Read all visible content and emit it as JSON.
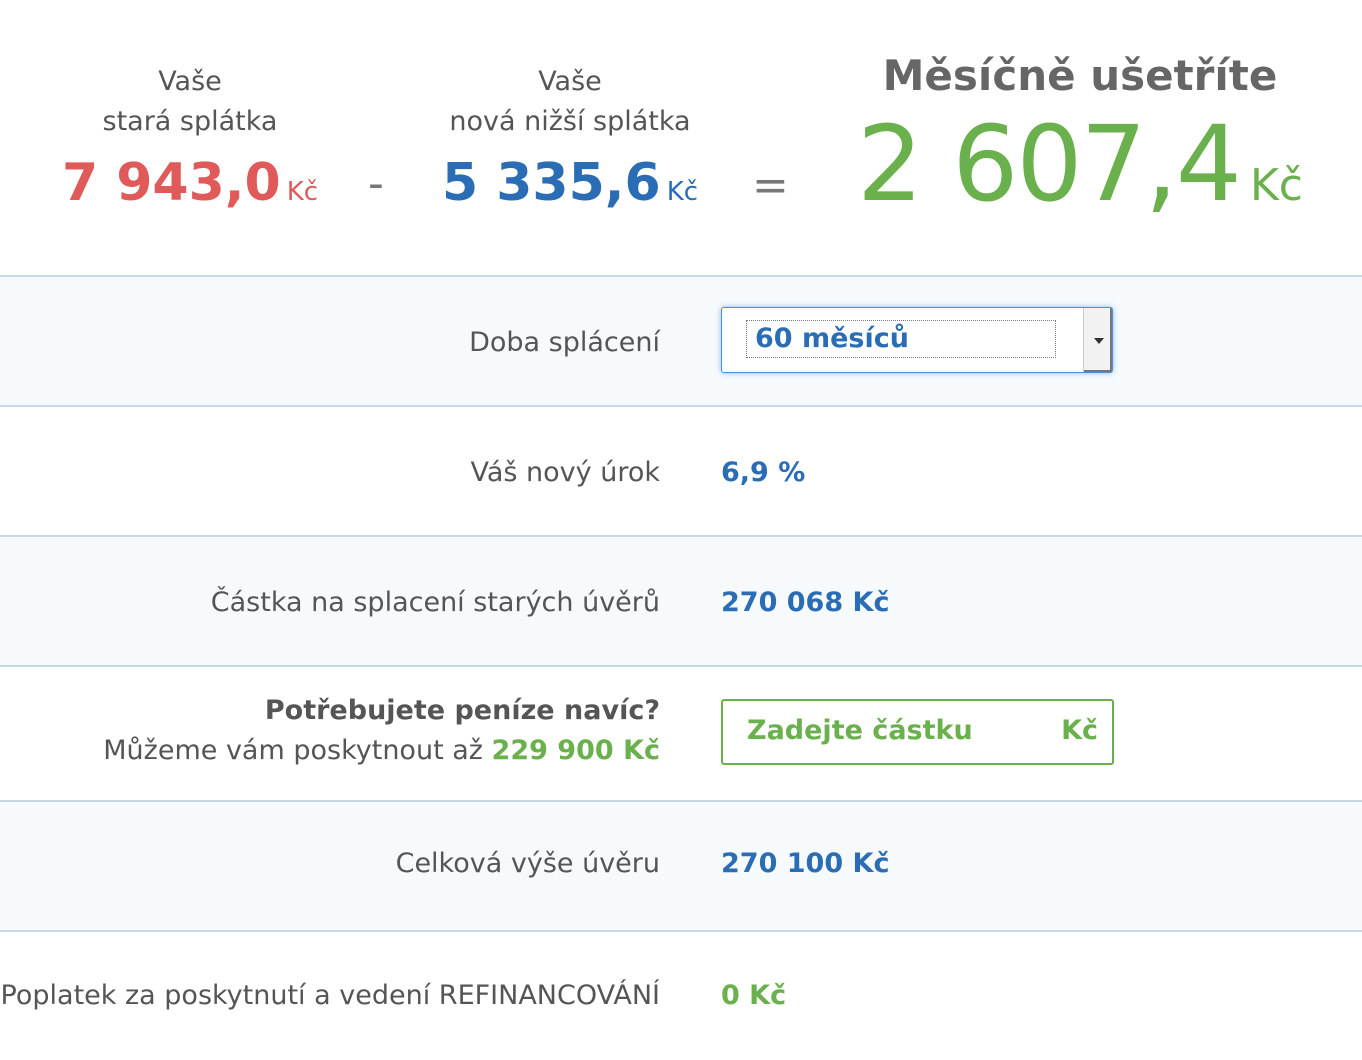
{
  "summary": {
    "old": {
      "label_line1": "Vaše",
      "label_line2": "stará splátka",
      "amount": "7 943,0",
      "currency": "Kč"
    },
    "minus": "-",
    "new": {
      "label_line1": "Vaše",
      "label_line2": "nová nižší splátka",
      "amount": "5 335,6",
      "currency": "Kč"
    },
    "equals": "=",
    "savings": {
      "label": "Měsíčně ušetříte",
      "amount": "2 607,4",
      "currency": "Kč"
    }
  },
  "rows": {
    "term": {
      "label": "Doba splácení",
      "selected": "60 měsíců"
    },
    "rate": {
      "label": "Váš nový úrok",
      "value": "6,9 %"
    },
    "payoff": {
      "label": "Částka na splacení starých úvěrů",
      "value": "270 068 Kč"
    },
    "extra": {
      "question": "Potřebujete peníze navíc?",
      "offer_prefix": "Můžeme vám poskytnout až",
      "offer_amount": "229 900 Kč",
      "placeholder": "Zadejte částku",
      "currency": "Kč"
    },
    "total": {
      "label": "Celková výše úvěru",
      "value": "270 100 Kč"
    },
    "fee": {
      "label": "Poplatek za poskytnutí a vedení REFINANCOVÁNÍ",
      "value": "0 Kč"
    }
  },
  "colors": {
    "old": "#e05a5a",
    "new": "#2a6db5",
    "savings": "#6ab04c",
    "border": "#c5d8e6"
  }
}
